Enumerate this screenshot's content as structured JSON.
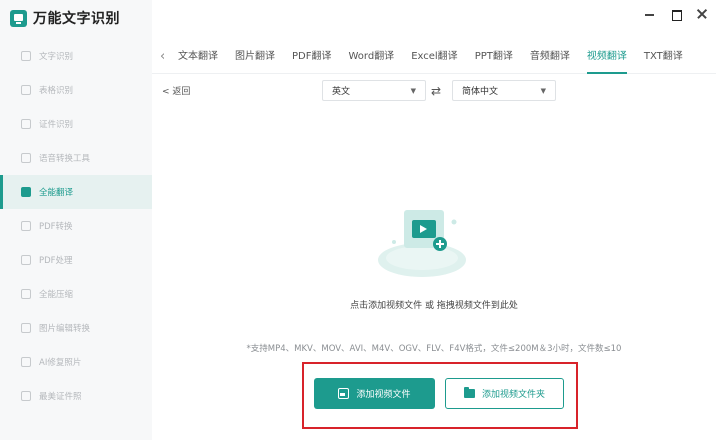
{
  "app": {
    "title": "万能文字识别"
  },
  "sidebar": {
    "items": [
      {
        "label": "文字识别",
        "active": false
      },
      {
        "label": "表格识别",
        "active": false
      },
      {
        "label": "证件识别",
        "active": false
      },
      {
        "label": "语音转换工具",
        "active": false
      },
      {
        "label": "全能翻译",
        "active": true
      },
      {
        "label": "PDF转换",
        "active": false
      },
      {
        "label": "PDF处理",
        "active": false
      },
      {
        "label": "全能压缩",
        "active": false
      },
      {
        "label": "图片编辑转换",
        "active": false
      },
      {
        "label": "AI修复照片",
        "active": false
      },
      {
        "label": "最美证件照",
        "active": false
      }
    ]
  },
  "tabs": {
    "items": [
      {
        "label": "文本翻译",
        "active": false
      },
      {
        "label": "图片翻译",
        "active": false
      },
      {
        "label": "PDF翻译",
        "active": false
      },
      {
        "label": "Word翻译",
        "active": false
      },
      {
        "label": "Excel翻译",
        "active": false
      },
      {
        "label": "PPT翻译",
        "active": false
      },
      {
        "label": "音频翻译",
        "active": false
      },
      {
        "label": "视频翻译",
        "active": true
      },
      {
        "label": "TXT翻译",
        "active": false
      }
    ]
  },
  "toolbar": {
    "back_label": "< 返回",
    "source_lang": "英文",
    "target_lang": "简体中文"
  },
  "main": {
    "drop_hint": "点击添加视频文件 或 拖拽视频文件到此处",
    "formats_note": "*支持MP4、MKV、MOV、AVI、M4V、OGV、FLV、F4V格式，文件≤200M＆3小时，文件数≤10",
    "add_file_label": "添加视频文件",
    "add_folder_label": "添加视频文件夹"
  },
  "colors": {
    "accent": "#1d9b8e",
    "highlight": "#d8232a",
    "sidebar_bg": "#f7f8f9"
  },
  "icons": {
    "app_logo": "app-logo-icon",
    "swap": "swap-arrows-icon",
    "file_button": "video-file-icon",
    "folder_button": "folder-icon"
  }
}
